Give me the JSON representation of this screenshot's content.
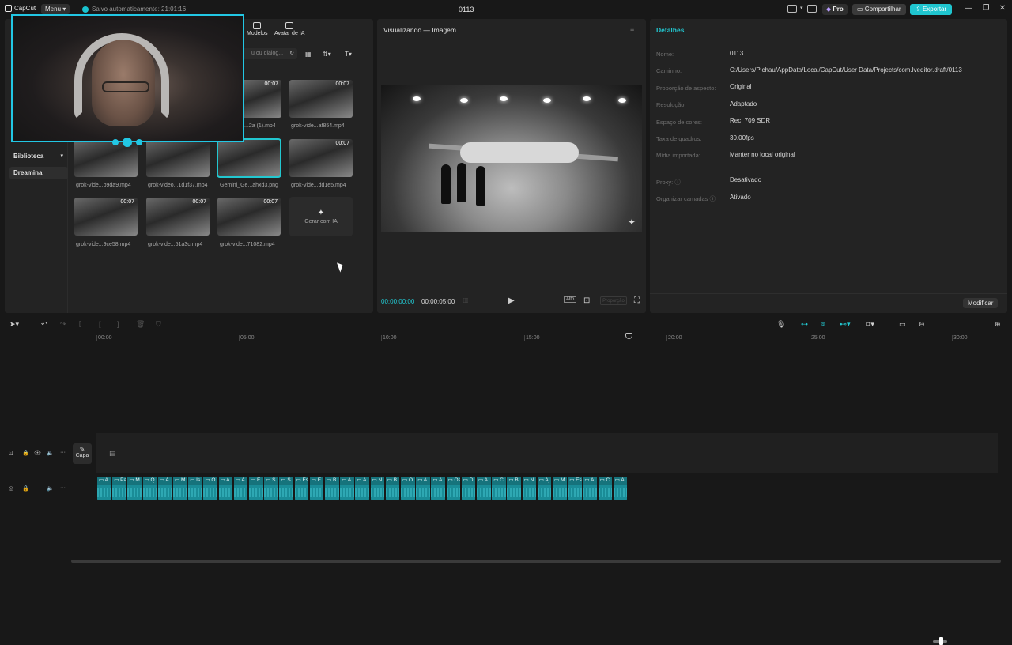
{
  "app": {
    "logo": "CapCut",
    "menu": "Menu",
    "autosave": "Salvo automaticamente: 21:01:16",
    "project_title": "0113",
    "pro": "Pro",
    "share": "Compartilhar",
    "export": "Exportar",
    "accent": "#22c7d0"
  },
  "media": {
    "tabs": [
      "Modelos",
      "Avatar de IA"
    ],
    "search_placeholder": "u ou diálog...",
    "sidebar": [
      "Biblioteca",
      "Dreamina"
    ],
    "items": [
      {
        "label": "...2a (1).mp4",
        "duration": "00:07"
      },
      {
        "label": "grok-vide...af854.mp4",
        "duration": "00:07"
      },
      {
        "label": "grok-vide...b9da9.mp4",
        "duration": ""
      },
      {
        "label": "grok-video...1d1f37.mp4",
        "duration": ""
      },
      {
        "label": "Gemini_Ge...ahxd3.png",
        "duration": ""
      },
      {
        "label": "grok-vide...dd1e5.mp4",
        "duration": "00:07"
      },
      {
        "label": "grok-vide...9ce58.mp4",
        "duration": "00:07"
      },
      {
        "label": "grok-vide...51a3c.mp4",
        "duration": "00:07"
      },
      {
        "label": "grok-vide...71082.mp4",
        "duration": "00:07"
      }
    ],
    "generate_ai": "Gerar com IA"
  },
  "preview": {
    "title": "Visualizando — Imagem",
    "current_time": "00:00:00:00",
    "total_time": "00:00:05:00",
    "quality": "Alto",
    "ratio": "Proporção"
  },
  "details": {
    "title": "Detalhes",
    "fields": [
      {
        "label": "Nome:",
        "value": "0113"
      },
      {
        "label": "Caminho:",
        "value": "C:/Users/Pichau/AppData/Local/CapCut/User Data/Projects/com.lveditor.draft/0113"
      },
      {
        "label": "Proporção de aspecto:",
        "value": "Original"
      },
      {
        "label": "Resolução:",
        "value": "Adaptado"
      },
      {
        "label": "Espaço de cores:",
        "value": "Rec. 709 SDR"
      },
      {
        "label": "Taxa de quadros:",
        "value": "30.00fps"
      },
      {
        "label": "Mídia importada:",
        "value": "Manter no local original"
      },
      {
        "label": "Proxy:",
        "value": "Desativado"
      },
      {
        "label": "Organizar camadas",
        "value": "Ativado"
      }
    ],
    "modify": "Modificar"
  },
  "timeline": {
    "ruler": [
      "00:00",
      "05:00",
      "10:00",
      "15:00",
      "20:00",
      "25:00",
      "30:00"
    ],
    "cover": "Capa",
    "audio_clips": [
      "A",
      "Pa",
      "M",
      "Q",
      "A",
      "M",
      "Is",
      "O",
      "A",
      "A",
      "E",
      "S",
      "S",
      "Es",
      "E",
      "B",
      "A",
      "A",
      "N",
      "B",
      "O",
      "A",
      "A",
      "Os",
      "D",
      "A",
      "C",
      "B",
      "N",
      "Aj",
      "M",
      "Es",
      "A",
      "C",
      "A"
    ]
  }
}
